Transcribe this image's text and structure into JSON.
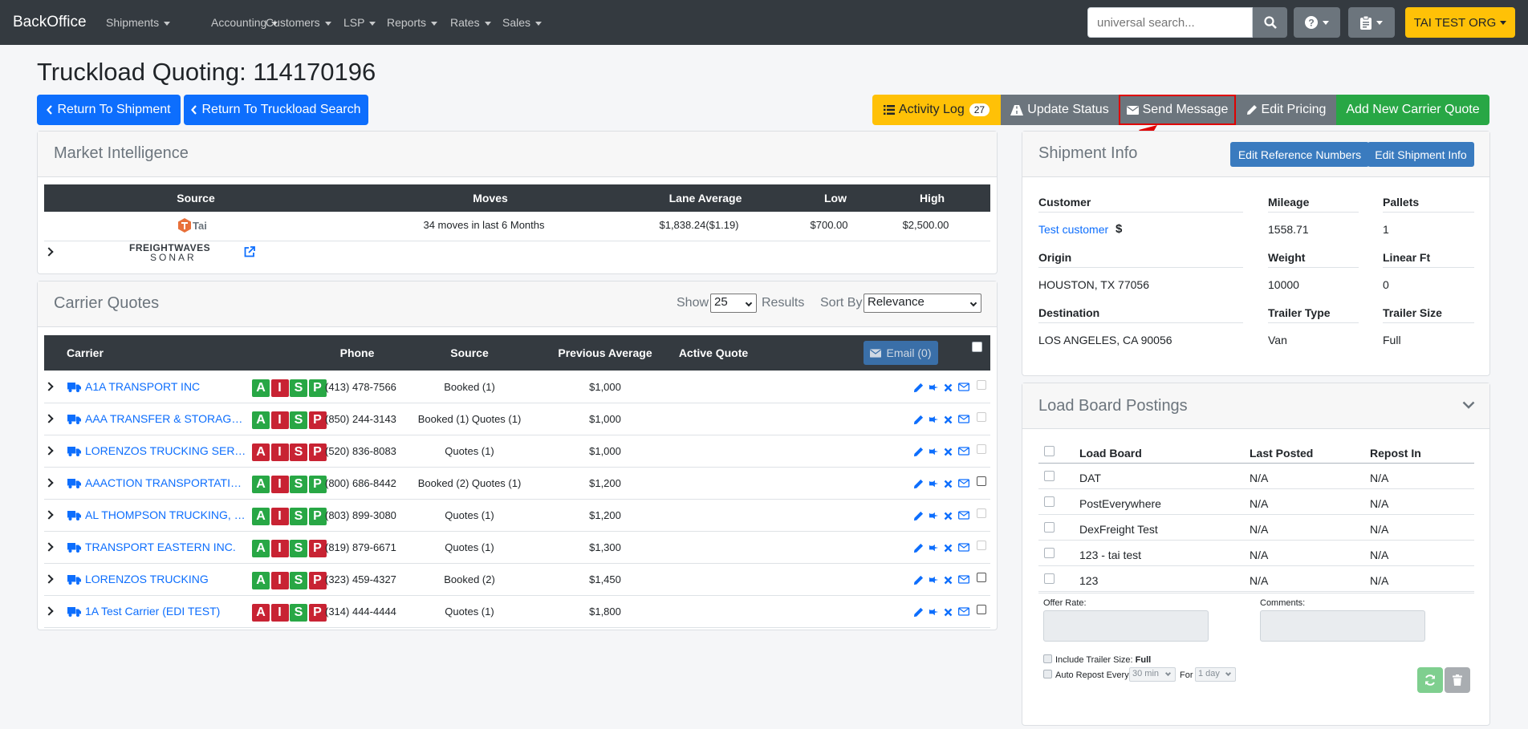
{
  "nav": {
    "brand": "BackOffice",
    "items": [
      "Shipments",
      "Accounting",
      "Customers",
      "LSP",
      "Reports",
      "Rates",
      "Sales"
    ],
    "search_placeholder": "universal search...",
    "org": "TAI TEST ORG"
  },
  "page": {
    "title": "Truckload Quoting: 114170196",
    "return_shipment": "Return To Shipment",
    "return_search": "Return To Truckload Search",
    "activity_log": "Activity Log",
    "activity_count": "27",
    "update_status": "Update Status",
    "send_message": "Send Message",
    "edit_pricing": "Edit Pricing",
    "add_quote": "Add New Carrier Quote"
  },
  "market": {
    "title": "Market Intelligence",
    "headers": [
      "Source",
      "Moves",
      "Lane Average",
      "Low",
      "High"
    ],
    "tai_row": {
      "logo": "Tai",
      "moves": "34 moves in last 6 Months",
      "lane_avg": "$1,838.24($1.19)",
      "low": "$700.00",
      "high": "$2,500.00"
    },
    "fw_logo_top": "FREIGHTWAVES",
    "fw_logo_bottom": "SONAR"
  },
  "quotes": {
    "title": "Carrier Quotes",
    "show_label": "Show",
    "show_value": "25",
    "results_label": "Results",
    "sort_label": "Sort By",
    "sort_value": "Relevance",
    "headers": {
      "carrier": "Carrier",
      "phone": "Phone",
      "source": "Source",
      "prev_avg": "Previous Average",
      "active": "Active Quote"
    },
    "email_btn": "Email (0)",
    "badges": [
      "A",
      "I",
      "S",
      "P"
    ],
    "rows": [
      {
        "carrier": "A1A TRANSPORT INC",
        "phone": "(413) 478-7566",
        "source": "Booked (1)",
        "prev": "$1,000",
        "badge_colors": [
          "g",
          "r",
          "g",
          "g"
        ]
      },
      {
        "carrier": "AAA TRANSFER & STORAGE, I...",
        "phone": "(850) 244-3143",
        "source": "Booked (1) Quotes (1)",
        "prev": "$1,000",
        "badge_colors": [
          "g",
          "r",
          "g",
          "r"
        ]
      },
      {
        "carrier": "LORENZOS TRUCKING SERVIC...",
        "phone": "(520) 836-8083",
        "source": "Quotes (1)",
        "prev": "$1,000",
        "badge_colors": [
          "r",
          "r",
          "r",
          "r"
        ]
      },
      {
        "carrier": "AAACTION TRANSPORTATION...",
        "phone": "(800) 686-8442",
        "source": "Booked (2) Quotes (1)",
        "prev": "$1,200",
        "badge_colors": [
          "g",
          "r",
          "g",
          "g"
        ]
      },
      {
        "carrier": "AL THOMPSON TRUCKING, IN...",
        "phone": "(803) 899-3080",
        "source": "Quotes (1)",
        "prev": "$1,200",
        "badge_colors": [
          "g",
          "r",
          "g",
          "g"
        ]
      },
      {
        "carrier": "TRANSPORT EASTERN INC.",
        "phone": "(819) 879-6671",
        "source": "Quotes (1)",
        "prev": "$1,300",
        "badge_colors": [
          "g",
          "r",
          "g",
          "r"
        ]
      },
      {
        "carrier": "LORENZOS TRUCKING",
        "phone": "(323) 459-4327",
        "source": "Booked (2)",
        "prev": "$1,450",
        "badge_colors": [
          "g",
          "r",
          "g",
          "r"
        ]
      },
      {
        "carrier": "1A Test Carrier (EDI TEST)",
        "phone": "(314) 444-4444",
        "source": "Quotes (1)",
        "prev": "$1,800",
        "badge_colors": [
          "r",
          "r",
          "g",
          "r"
        ]
      }
    ]
  },
  "shipment": {
    "title": "Shipment Info",
    "edit_refs": "Edit Reference Numbers",
    "edit_info": "Edit Shipment Info",
    "customer_label": "Customer",
    "customer": "Test customer",
    "dollar": "$",
    "mileage_label": "Mileage",
    "mileage": "1558.71",
    "pallets_label": "Pallets",
    "pallets": "1",
    "origin_label": "Origin",
    "origin": "HOUSTON, TX 77056",
    "weight_label": "Weight",
    "weight": "10000",
    "linear_label": "Linear Ft",
    "linear": "0",
    "dest_label": "Destination",
    "dest": "LOS ANGELES, CA 90056",
    "trailer_type_label": "Trailer Type",
    "trailer_type": "Van",
    "trailer_size_label": "Trailer Size",
    "trailer_size": "Full"
  },
  "loadboard": {
    "title": "Load Board Postings",
    "headers": [
      "Load Board",
      "Last Posted",
      "Repost In"
    ],
    "rows": [
      {
        "name": "DAT",
        "last": "N/A",
        "repost": "N/A"
      },
      {
        "name": "PostEverywhere",
        "last": "N/A",
        "repost": "N/A"
      },
      {
        "name": "DexFreight Test",
        "last": "N/A",
        "repost": "N/A"
      },
      {
        "name": "123 - tai test",
        "last": "N/A",
        "repost": "N/A"
      },
      {
        "name": "123",
        "last": "N/A",
        "repost": "N/A"
      }
    ],
    "offer_label": "Offer Rate:",
    "comments_label": "Comments:",
    "include_label": "Include Trailer Size:",
    "include_value": "Full",
    "auto_label": "Auto Repost Every",
    "auto_value": "30 min",
    "for_label": "For",
    "for_value": "1 day"
  },
  "colors": {
    "navbar": "#343a40",
    "primary": "#0d6efd",
    "warning": "#ffc107",
    "success": "#28a745",
    "highlight": "#e00000"
  }
}
